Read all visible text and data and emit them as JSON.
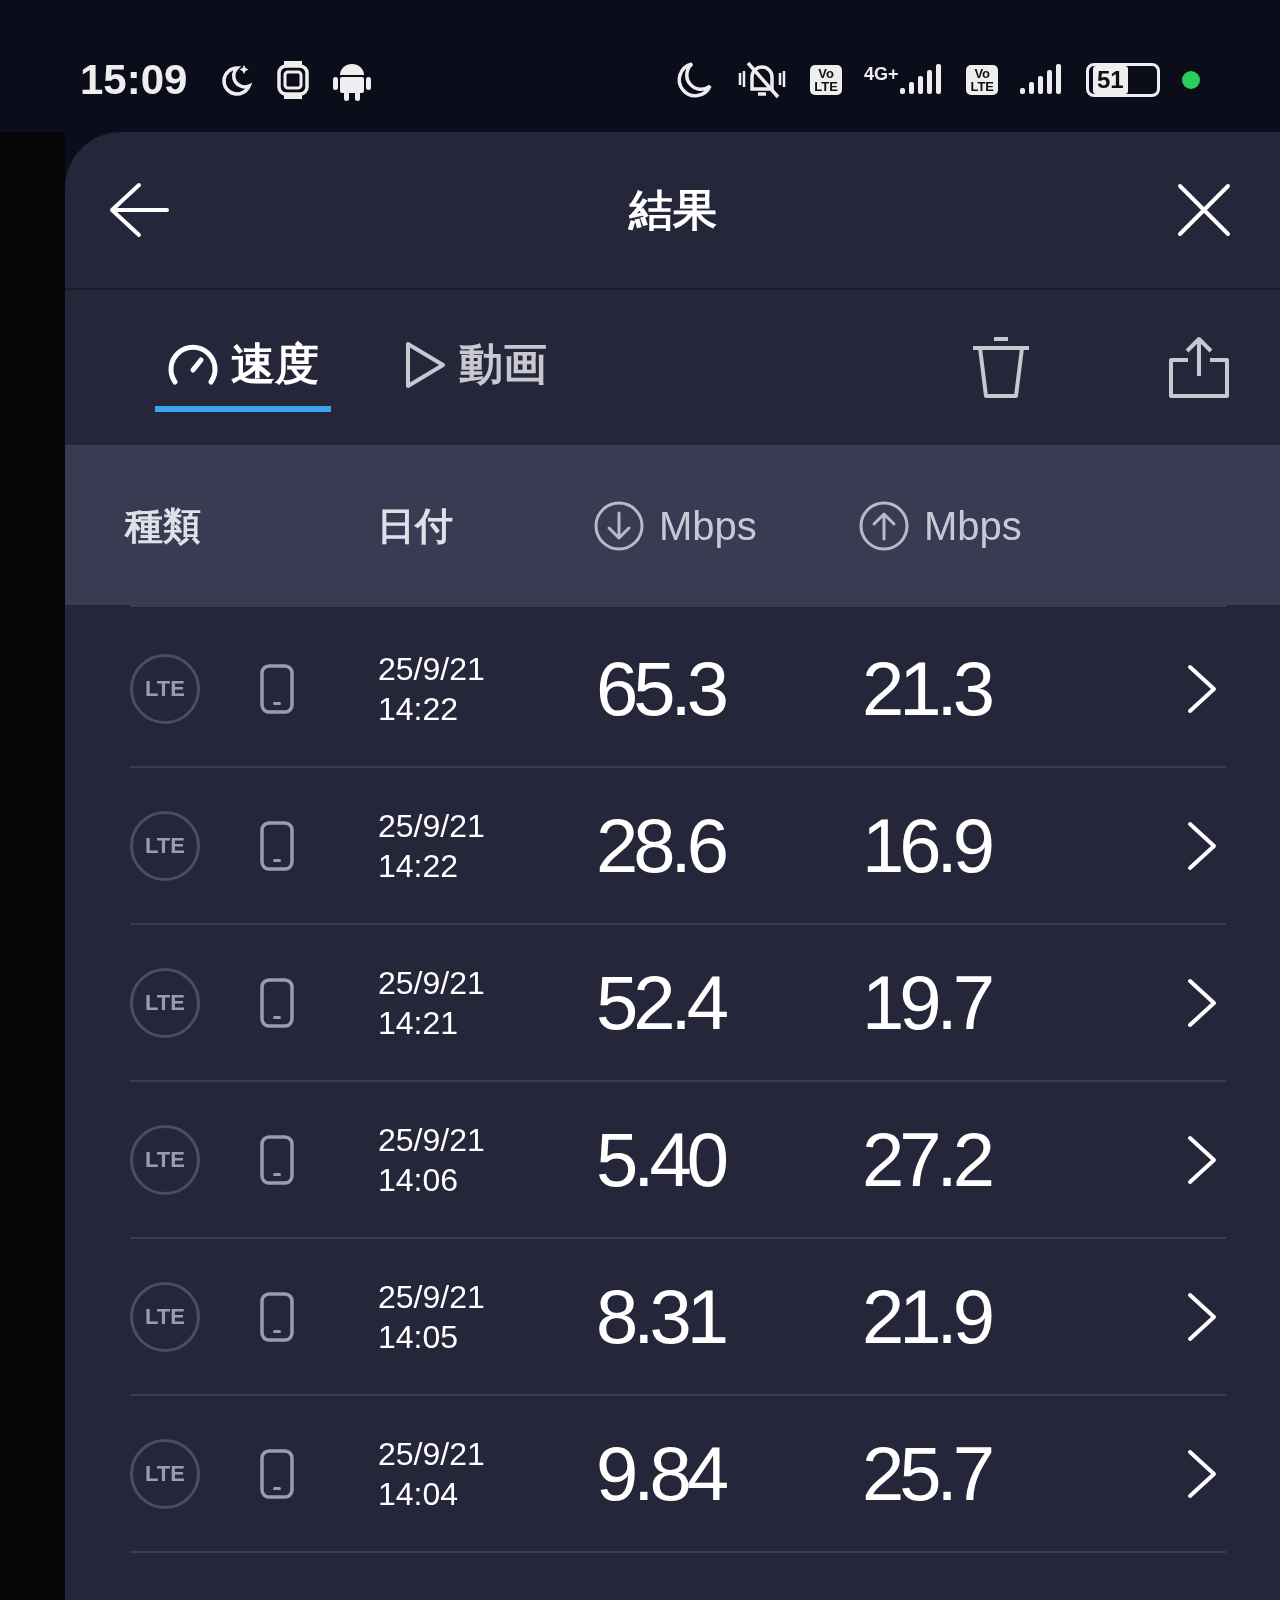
{
  "status_bar": {
    "time": "15:09",
    "network": "4G+",
    "volte": [
      {
        "top": "Vo",
        "bottom": "LTE"
      },
      {
        "top": "Vo",
        "bottom": "LTE"
      }
    ],
    "battery": "51"
  },
  "header": {
    "title": "結果"
  },
  "tabs": [
    {
      "label": "速度",
      "kind": "speed",
      "selected": true
    },
    {
      "label": "動画",
      "kind": "video",
      "selected": false
    }
  ],
  "columns": [
    {
      "label": "種類"
    },
    {
      "label": "日付"
    },
    {
      "label": "Mbps",
      "kind": "download"
    },
    {
      "label": "Mbps",
      "kind": "upload"
    }
  ],
  "rows": [
    {
      "type": "LTE",
      "date": "25/9/21",
      "time": "14:22",
      "download": "65.3",
      "upload": "21.3"
    },
    {
      "type": "LTE",
      "date": "25/9/21",
      "time": "14:22",
      "download": "28.6",
      "upload": "16.9"
    },
    {
      "type": "LTE",
      "date": "25/9/21",
      "time": "14:21",
      "download": "52.4",
      "upload": "19.7"
    },
    {
      "type": "LTE",
      "date": "25/9/21",
      "time": "14:06",
      "download": "5.40",
      "upload": "27.2"
    },
    {
      "type": "LTE",
      "date": "25/9/21",
      "time": "14:05",
      "download": "8.31",
      "upload": "21.9"
    },
    {
      "type": "LTE",
      "date": "25/9/21",
      "time": "14:04",
      "download": "9.84",
      "upload": "25.7"
    }
  ]
}
